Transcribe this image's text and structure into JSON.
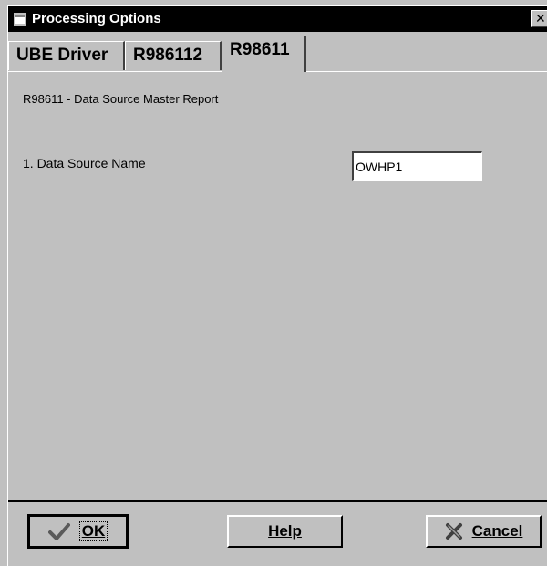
{
  "window": {
    "title": "Processing Options",
    "close_glyph": "✕"
  },
  "tabs": [
    {
      "label": "UBE Driver",
      "active": false
    },
    {
      "label": "R986112",
      "active": false
    },
    {
      "label": "R98611",
      "active": true
    }
  ],
  "panel": {
    "report_title": "R98611 - Data Source Master Report",
    "field_label": "1.  Data Source Name",
    "field_value": "OWHP1"
  },
  "buttons": {
    "ok_label": "OK",
    "help_label": "Help",
    "cancel_label": "Cancel"
  },
  "icons": {
    "title": "window-app-icon",
    "ok": "checkmark-icon",
    "cancel": "cross-icon"
  },
  "colors": {
    "face": "#c0c0c0",
    "titlebar": "#000000",
    "ok_check": "#5a5a5a"
  }
}
